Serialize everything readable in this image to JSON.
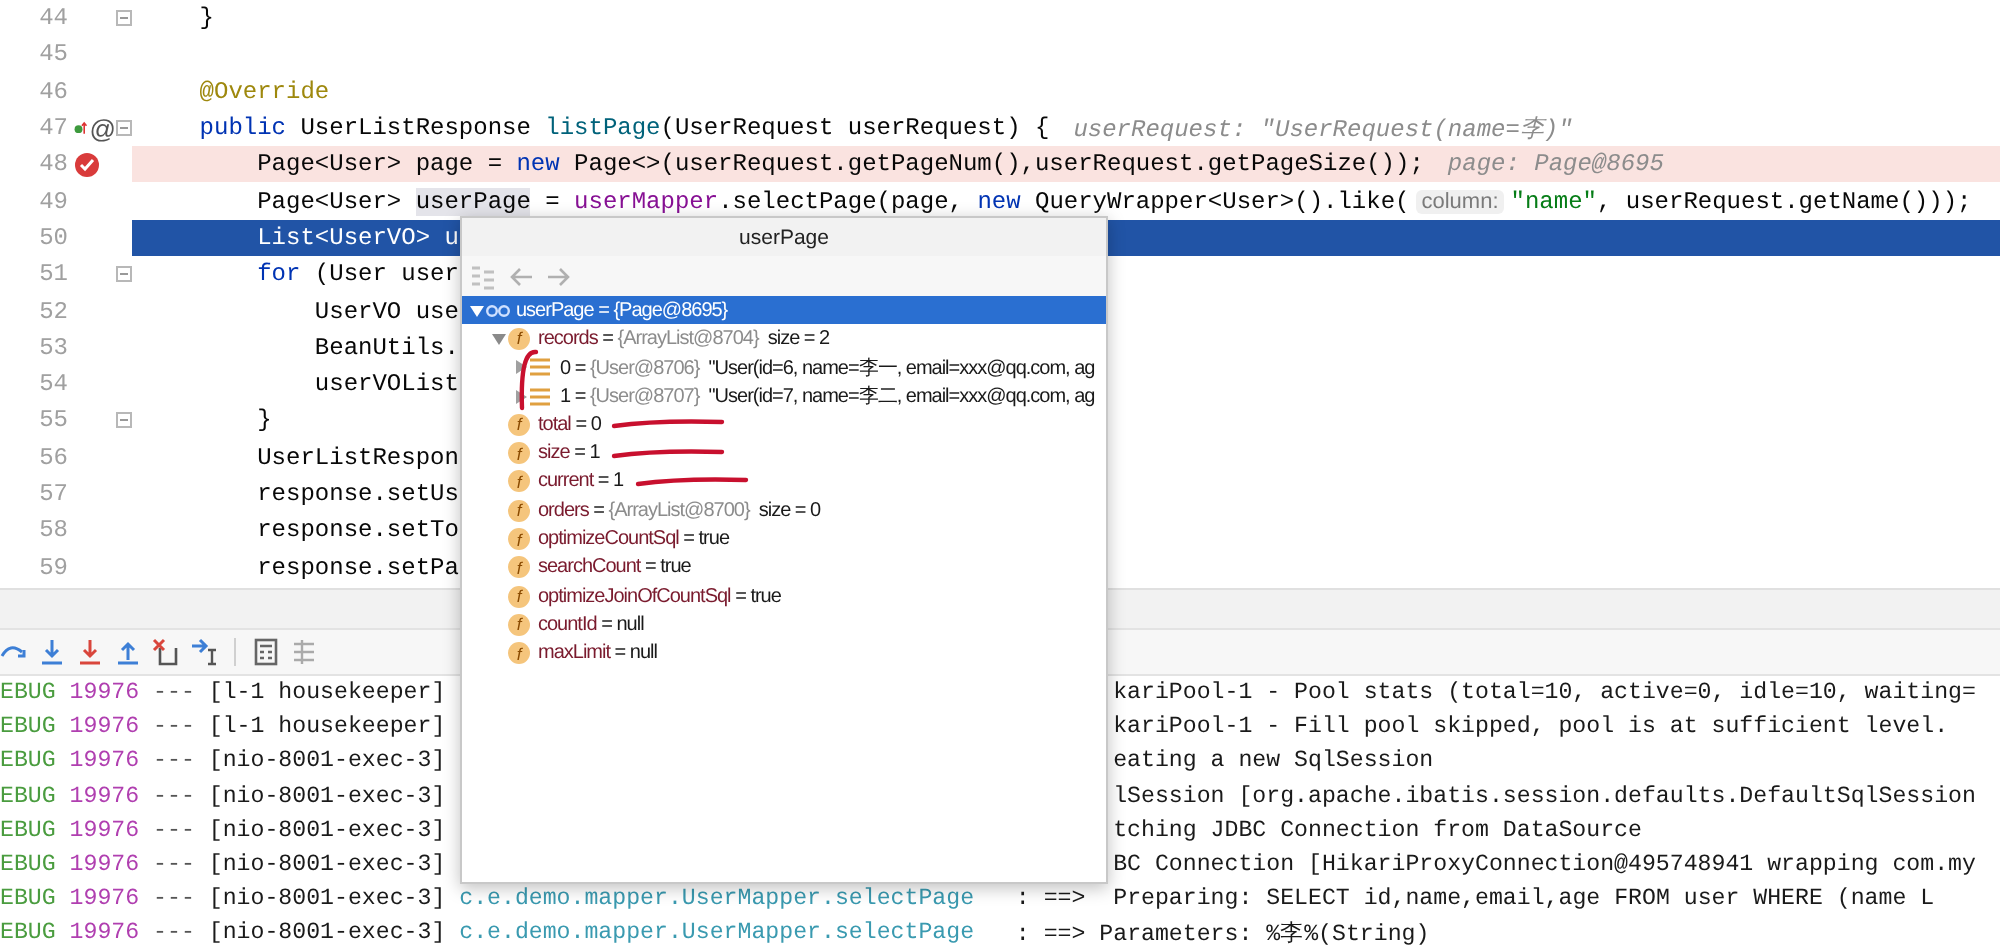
{
  "editor": {
    "lines": [
      {
        "number": "44",
        "fold": true,
        "breakpoint": false,
        "execution_point": false,
        "tokens": [
          {
            "text": "    }",
            "kind": "plain"
          }
        ]
      },
      {
        "number": "45",
        "fold": false,
        "breakpoint": false,
        "execution_point": false
      },
      {
        "number": "46",
        "fold": false,
        "breakpoint": false,
        "execution_point": false,
        "tokens": [
          {
            "text": "    @Override",
            "kind": "annotation"
          }
        ]
      },
      {
        "number": "47",
        "fold": true,
        "breakpoint": false,
        "execution_point": false,
        "gutter_marks": [
          {
            "kind": "override"
          },
          {
            "kind": "text",
            "text": "@"
          }
        ],
        "tokens": [
          {
            "text": "    public",
            "kind": "keyword"
          },
          {
            "text": " UserListResponse ",
            "kind": "plain"
          },
          {
            "text": "listPage",
            "kind": "method"
          },
          {
            "text": "(UserRequest userRequest) {",
            "kind": "plain"
          },
          {
            "text": "userRequest: \"UserRequest(name=李)\"",
            "kind": "inline-hint"
          }
        ]
      },
      {
        "number": "48",
        "fold": false,
        "breakpoint": true,
        "execution_point": false,
        "tokens": [
          {
            "text": "        Page<User> page = ",
            "kind": "plain"
          },
          {
            "text": "new",
            "kind": "keyword"
          },
          {
            "text": " Page<>(userRequest.getPageNum(),userRequest.getPageSize());",
            "kind": "plain"
          },
          {
            "text": "page: Page@8695",
            "kind": "inline-hint"
          }
        ]
      },
      {
        "number": "49",
        "fold": false,
        "breakpoint": false,
        "execution_point": false,
        "tokens": [
          {
            "text": "        Page<User> ",
            "kind": "plain"
          },
          {
            "text": "userPage",
            "kind": "highlight"
          },
          {
            "text": " = ",
            "kind": "plain"
          },
          {
            "text": "userMapper",
            "kind": "field"
          },
          {
            "text": ".selectPage(page, ",
            "kind": "plain"
          },
          {
            "text": "new",
            "kind": "keyword"
          },
          {
            "text": " QueryWrapper<User>().like(",
            "kind": "plain"
          },
          {
            "text": "column:",
            "kind": "param-hint"
          },
          {
            "text": "\"name\"",
            "kind": "string"
          },
          {
            "text": ", userRequest.getName()));",
            "kind": "plain"
          }
        ]
      },
      {
        "number": "50",
        "fold": false,
        "breakpoint": false,
        "execution_point": true,
        "tokens": [
          {
            "text": "        List<UserVO> u",
            "kind": "plain"
          }
        ]
      },
      {
        "number": "51",
        "fold": true,
        "breakpoint": false,
        "execution_point": false,
        "tokens": [
          {
            "text": "        for",
            "kind": "keyword"
          },
          {
            "text": " (User user",
            "kind": "plain"
          }
        ]
      },
      {
        "number": "52",
        "fold": false,
        "breakpoint": false,
        "execution_point": false,
        "tokens": [
          {
            "text": "            UserVO use",
            "kind": "plain"
          }
        ]
      },
      {
        "number": "53",
        "fold": false,
        "breakpoint": false,
        "execution_point": false,
        "tokens": [
          {
            "text": "            BeanUtils.",
            "kind": "plain"
          }
        ]
      },
      {
        "number": "54",
        "fold": false,
        "breakpoint": false,
        "execution_point": false,
        "tokens": [
          {
            "text": "            userVOList",
            "kind": "plain"
          }
        ]
      },
      {
        "number": "55",
        "fold": true,
        "breakpoint": false,
        "execution_point": false,
        "tokens": [
          {
            "text": "        }",
            "kind": "plain"
          }
        ]
      },
      {
        "number": "56",
        "fold": false,
        "breakpoint": false,
        "execution_point": false,
        "tokens": [
          {
            "text": "        UserListRespon",
            "kind": "plain"
          }
        ]
      },
      {
        "number": "57",
        "fold": false,
        "breakpoint": false,
        "execution_point": false,
        "tokens": [
          {
            "text": "        response.setUs",
            "kind": "plain"
          }
        ]
      },
      {
        "number": "58",
        "fold": false,
        "breakpoint": false,
        "execution_point": false,
        "tokens": [
          {
            "text": "        response.setTo",
            "kind": "plain"
          }
        ]
      },
      {
        "number": "59",
        "fold": false,
        "breakpoint": false,
        "execution_point": false,
        "tokens": [
          {
            "text": "        response.setPa",
            "kind": "plain"
          }
        ]
      }
    ]
  },
  "popup": {
    "title": "userPage",
    "tree": [
      {
        "kind": "watch",
        "name": "userPage",
        "op": "=",
        "ref": "{Page@8695}",
        "expanded": true,
        "selected": true,
        "marked": false,
        "children": [
          {
            "kind": "field",
            "badge": "f",
            "name": "records",
            "op": "=",
            "ref": "{ArrayList@8704}",
            "value": "size = 2",
            "expanded": true,
            "selected": false,
            "marked": true,
            "children": [
              {
                "kind": "element",
                "name": "0",
                "op": "=",
                "ref": "{User@8706}",
                "value": "\"User(id=6, name=李一, email=xxx@qq.com, ag",
                "expanded": false,
                "selected": false,
                "marked": false
              },
              {
                "kind": "element",
                "name": "1",
                "op": "=",
                "ref": "{User@8707}",
                "value": "\"User(id=7, name=李二, email=xxx@qq.com, ag",
                "expanded": false,
                "selected": false,
                "marked": false
              }
            ]
          },
          {
            "kind": "field",
            "badge": "f",
            "name": "total",
            "op": "=",
            "value": "0",
            "selected": false,
            "marked": true
          },
          {
            "kind": "field",
            "badge": "f",
            "name": "size",
            "op": "=",
            "value": "1",
            "selected": false,
            "marked": true
          },
          {
            "kind": "field",
            "badge": "f",
            "name": "current",
            "op": "=",
            "value": "1",
            "selected": false,
            "marked": true
          },
          {
            "kind": "field",
            "badge": "f",
            "name": "orders",
            "op": "=",
            "ref": "{ArrayList@8700}",
            "value": "size = 0",
            "selected": false,
            "marked": false
          },
          {
            "kind": "field",
            "badge": "f",
            "name": "optimizeCountSql",
            "op": "=",
            "value": "true",
            "selected": false,
            "marked": false
          },
          {
            "kind": "field",
            "badge": "f",
            "name": "searchCount",
            "op": "=",
            "value": "true",
            "selected": false,
            "marked": false
          },
          {
            "kind": "field",
            "badge": "f",
            "name": "optimizeJoinOfCountSql",
            "op": "=",
            "value": "true",
            "selected": false,
            "marked": false
          },
          {
            "kind": "field",
            "badge": "f",
            "name": "countId",
            "op": "=",
            "value": "null",
            "selected": false,
            "marked": false
          },
          {
            "kind": "field",
            "badge": "f",
            "name": "maxLimit",
            "op": "=",
            "value": "null",
            "selected": false,
            "marked": false
          }
        ]
      }
    ]
  },
  "console": {
    "rows": [
      {
        "level": "EBUG",
        "pid": "19976",
        "separator": "---",
        "thread": "[l-1 housekeeper]",
        "message": "kariPool-1 - Pool stats (total=10, active=0, idle=10, waiting="
      },
      {
        "level": "EBUG",
        "pid": "19976",
        "separator": "---",
        "thread": "[l-1 housekeeper]",
        "message": "kariPool-1 - Fill pool skipped, pool is at sufficient level."
      },
      {
        "level": "EBUG",
        "pid": "19976",
        "separator": "---",
        "thread": "[nio-8001-exec-3]",
        "message": "eating a new SqlSession"
      },
      {
        "level": "EBUG",
        "pid": "19976",
        "separator": "---",
        "thread": "[nio-8001-exec-3]",
        "message": "lSession [org.apache.ibatis.session.defaults.DefaultSqlSession"
      },
      {
        "level": "EBUG",
        "pid": "19976",
        "separator": "---",
        "thread": "[nio-8001-exec-3]",
        "message": "tching JDBC Connection from DataSource"
      },
      {
        "level": "EBUG",
        "pid": "19976",
        "separator": "---",
        "thread": "[nio-8001-exec-3]",
        "message": "BC Connection [HikariProxyConnection@495748941 wrapping com.my"
      },
      {
        "level": "EBUG",
        "pid": "19976",
        "separator": "---",
        "thread": "[nio-8001-exec-3]",
        "logger": "c.e.demo.mapper.UserMapper.selectPage",
        "message": ": ==>  Preparing: SELECT id,name,email,age FROM user WHERE (name L"
      },
      {
        "level": "EBUG",
        "pid": "19976",
        "separator": "---",
        "thread": "[nio-8001-exec-3]",
        "logger": "c.e.demo.mapper.UserMapper.selectPage",
        "message": ": ==> Parameters: %李%(String)"
      }
    ]
  }
}
